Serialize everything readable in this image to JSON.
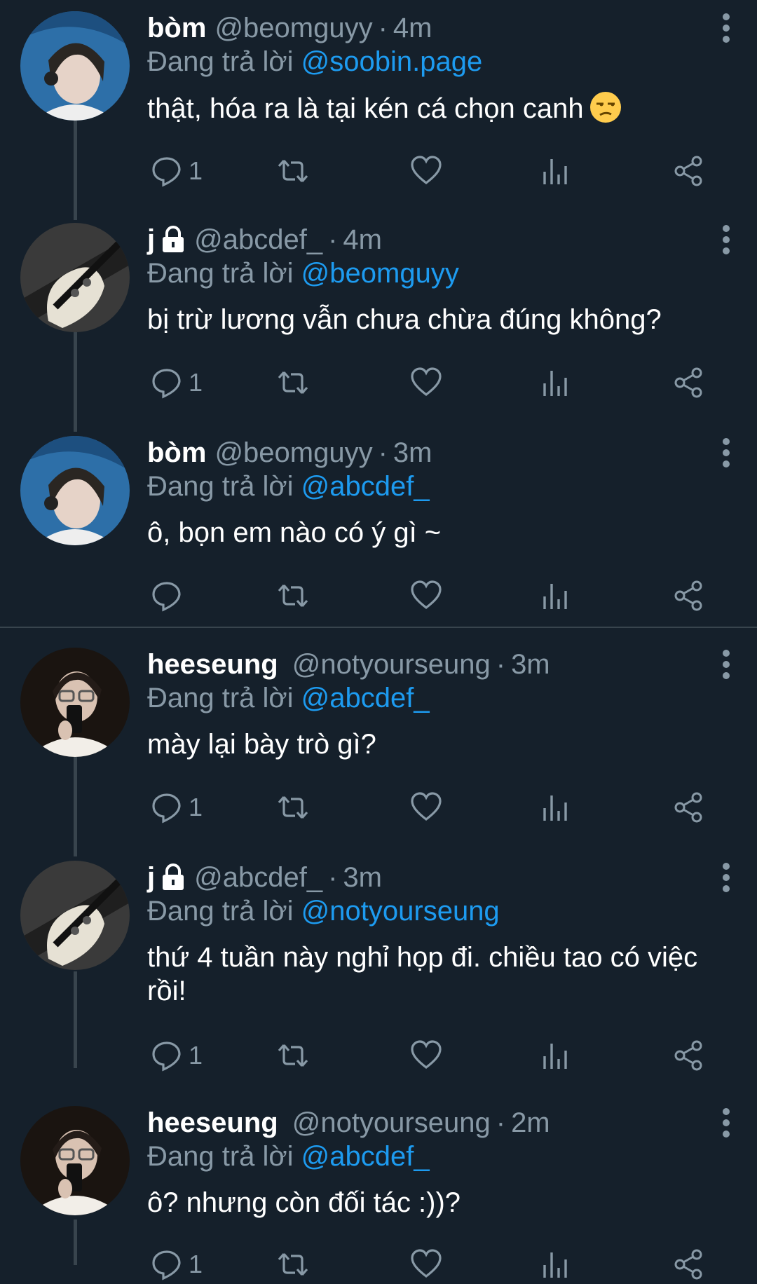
{
  "reply_prefix": "Đang trả lời",
  "tweets": [
    {
      "name": "bòm",
      "handle": "@beomguyy",
      "time": "4m",
      "reply_to": "@soobin.page",
      "text": "thật, hóa ra là tại kén cá chọn canh",
      "reply_count": "1",
      "locked": false,
      "avatar": "blue-hair"
    },
    {
      "name": "j",
      "handle": "@abcdef_",
      "time": "4m",
      "reply_to": "@beomguyy",
      "text": "bị trừ lương vẫn chưa chừa đúng không?",
      "reply_count": "1",
      "locked": true,
      "avatar": "guitar"
    },
    {
      "name": "bòm",
      "handle": "@beomguyy",
      "time": "3m",
      "reply_to": "@abcdef_",
      "text": "ô, bọn em nào có ý gì ~",
      "reply_count": "",
      "locked": false,
      "avatar": "blue-hair"
    },
    {
      "name": "heeseung",
      "handle": "@notyourseung",
      "time": "3m",
      "reply_to": "@abcdef_",
      "text": "mày lại bày trò gì?",
      "reply_count": "1",
      "locked": false,
      "avatar": "selfie"
    },
    {
      "name": "j",
      "handle": "@abcdef_",
      "time": "3m",
      "reply_to": "@notyourseung",
      "text": "thứ 4 tuần này nghỉ họp đi. chiều tao có việc rồi!",
      "reply_count": "1",
      "locked": true,
      "avatar": "guitar"
    },
    {
      "name": "heeseung",
      "handle": "@notyourseung",
      "time": "2m",
      "reply_to": "@abcdef_",
      "text": "ô? nhưng còn đối tác :))?",
      "reply_count": "1",
      "locked": false,
      "avatar": "selfie"
    }
  ],
  "colors": {
    "background": "#15202b",
    "secondary_text": "#8899a6",
    "accent": "#1d9bf0",
    "divider": "#38444d"
  }
}
